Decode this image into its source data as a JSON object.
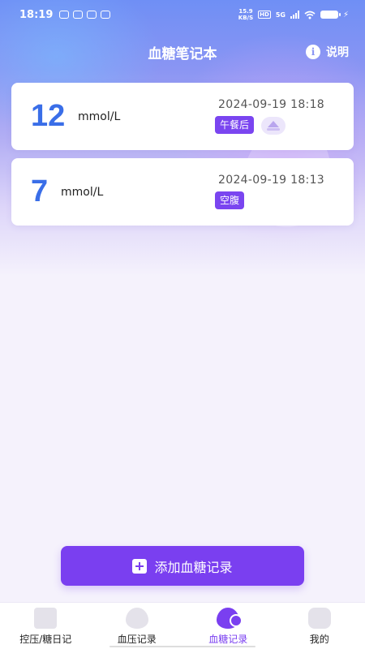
{
  "status_bar": {
    "time": "18:19",
    "net_speed_value": "15.9",
    "net_speed_unit": "KB/S",
    "hd": "HD",
    "network": "5G"
  },
  "header": {
    "title": "血糖笔记本",
    "help_label": "说明",
    "help_icon": "i"
  },
  "records": [
    {
      "value": "12",
      "unit": "mmol/L",
      "time": "2024-09-19 18:18",
      "tag": "午餐后"
    },
    {
      "value": "7",
      "unit": "mmol/L",
      "time": "2024-09-19 18:13",
      "tag": "空腹"
    }
  ],
  "add_button": {
    "label": "添加血糖记录"
  },
  "tabs": [
    {
      "label": "控压/糖日记",
      "icon": "diary-icon"
    },
    {
      "label": "血压记录",
      "icon": "blood-pressure-icon"
    },
    {
      "label": "血糖记录",
      "icon": "blood-sugar-icon"
    },
    {
      "label": "我的",
      "icon": "profile-icon"
    }
  ],
  "colors": {
    "accent": "#7a3ff0",
    "value_blue": "#3a6ee8"
  }
}
